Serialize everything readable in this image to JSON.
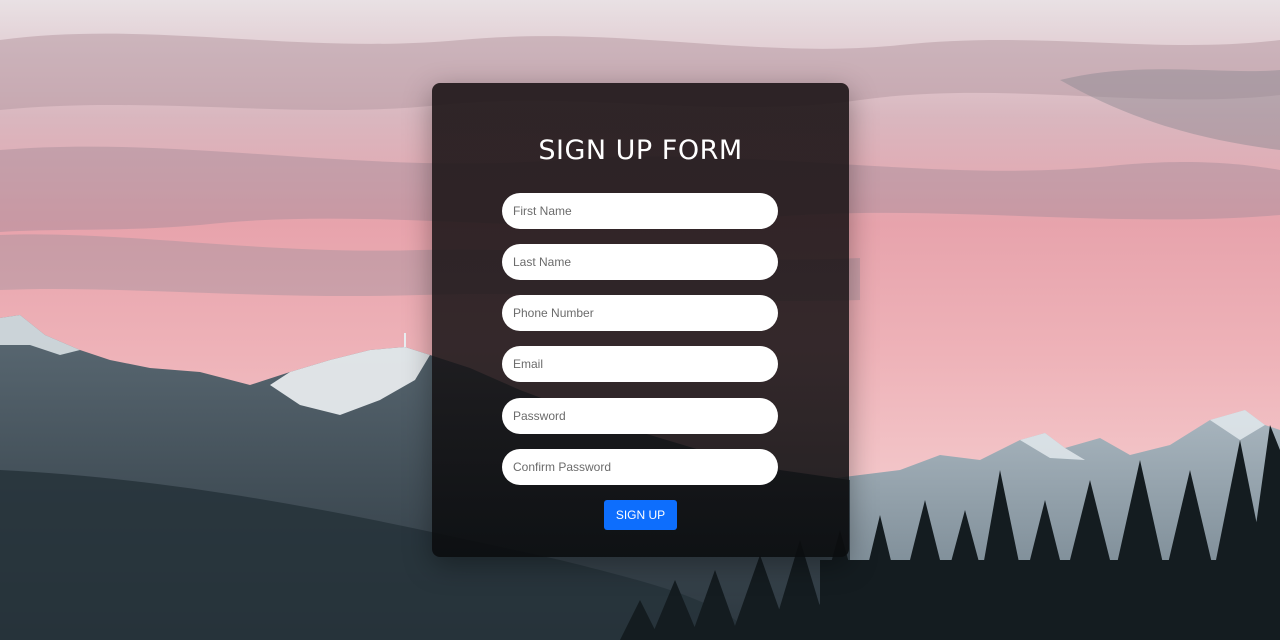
{
  "form": {
    "title": "SIGN UP FORM",
    "fields": [
      {
        "placeholder": "First Name",
        "value": ""
      },
      {
        "placeholder": "Last Name",
        "value": ""
      },
      {
        "placeholder": "Phone Number",
        "value": ""
      },
      {
        "placeholder": "Email",
        "value": ""
      },
      {
        "placeholder": "Password",
        "value": ""
      },
      {
        "placeholder": "Confirm Password",
        "value": ""
      }
    ],
    "submit_label": "SIGN UP"
  },
  "colors": {
    "button": "#0d6efd",
    "card": "#1c1416",
    "sky_pink": "#e8a0aa"
  }
}
